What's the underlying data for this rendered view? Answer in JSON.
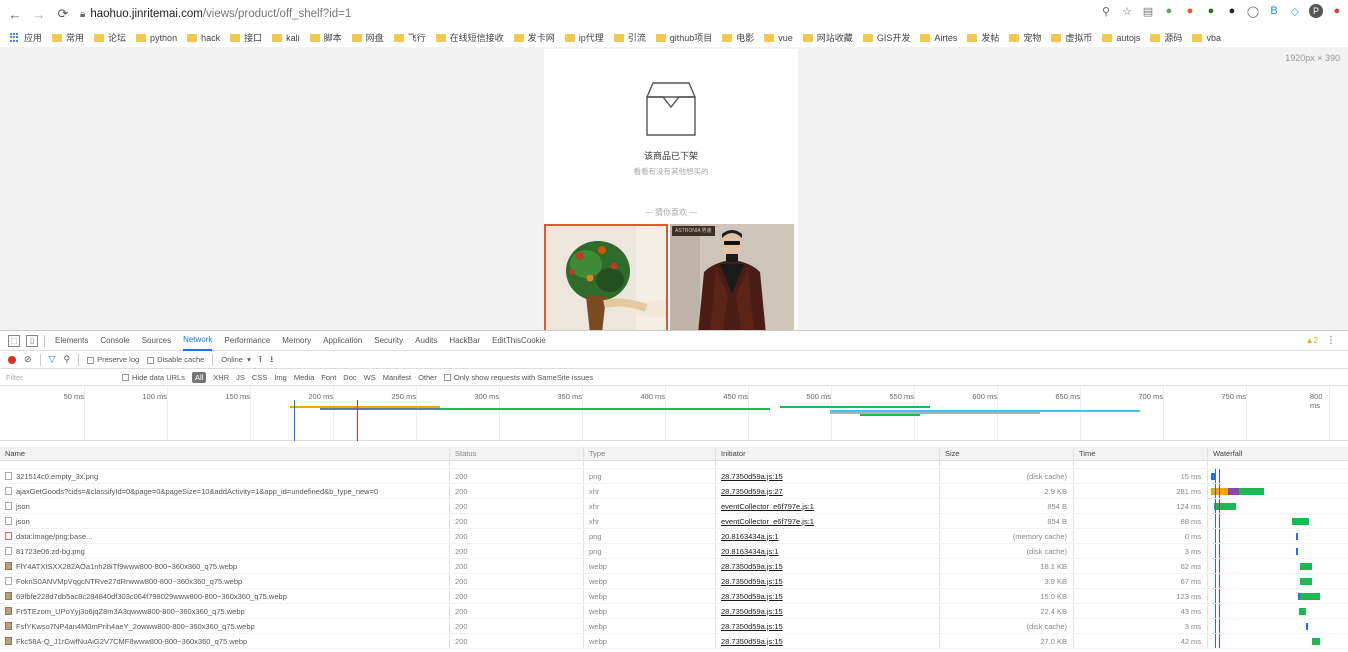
{
  "browser": {
    "url_host": "haohuo.jinritemai.com",
    "url_path": "/views/product/off_shelf?id=1",
    "extensions": [
      {
        "name": "zoom-icon",
        "label": "⚲",
        "color": "#666"
      },
      {
        "name": "star-icon",
        "label": "☆",
        "color": "#666"
      },
      {
        "name": "ext-1",
        "label": "▤",
        "color": "#7a7a7a"
      },
      {
        "name": "ext-2",
        "label": "●",
        "color": "#4caf50"
      },
      {
        "name": "ext-3",
        "label": "●",
        "color": "#f4511e"
      },
      {
        "name": "ext-4",
        "label": "●",
        "color": "#33691e"
      },
      {
        "name": "ext-5",
        "label": "●",
        "color": "#222"
      },
      {
        "name": "ext-6",
        "label": "◯",
        "color": "#666"
      },
      {
        "name": "ext-7",
        "label": "B",
        "color": "#1e88e5"
      },
      {
        "name": "ext-8",
        "label": "◇",
        "color": "#42a5f5"
      },
      {
        "name": "profile-avatar",
        "label": "P",
        "color": "#555"
      },
      {
        "name": "ext-9",
        "label": "●",
        "color": "#e53935"
      }
    ]
  },
  "bookmarks": [
    {
      "label": "应用",
      "type": "apps"
    },
    {
      "label": "常用"
    },
    {
      "label": "论坛"
    },
    {
      "label": "python"
    },
    {
      "label": "hack"
    },
    {
      "label": "接口"
    },
    {
      "label": "kali"
    },
    {
      "label": "脚本"
    },
    {
      "label": "网盘"
    },
    {
      "label": "飞行"
    },
    {
      "label": "在线短信接收"
    },
    {
      "label": "发卡网"
    },
    {
      "label": "ip代理"
    },
    {
      "label": "引流"
    },
    {
      "label": "github项目"
    },
    {
      "label": "电影"
    },
    {
      "label": "vue"
    },
    {
      "label": "网站收藏"
    },
    {
      "label": "GIS开发"
    },
    {
      "label": "Airtes"
    },
    {
      "label": "发帖"
    },
    {
      "label": "宠物"
    },
    {
      "label": "虚拟币"
    },
    {
      "label": "autojs"
    },
    {
      "label": "源码"
    },
    {
      "label": "vba"
    }
  ],
  "page": {
    "viewport_dims": "1920px × 390",
    "off_shelf_title": "该商品已下架",
    "off_shelf_subtitle": "看看有没有其他想买的",
    "guess_you_like": "— 猜你喜欢 —",
    "product2_badge": "ASTRONIA 男装"
  },
  "devtools": {
    "tabs": [
      "Elements",
      "Console",
      "Sources",
      "Network",
      "Performance",
      "Memory",
      "Application",
      "Security",
      "Audits",
      "HackBar",
      "EditThisCookie"
    ],
    "active_tab": "Network",
    "warning_count": "▲2",
    "preserve_log": "Preserve log",
    "disable_cache": "Disable cache",
    "throttling": "Online",
    "filter_placeholder": "Filter",
    "hide_data_urls": "Hide data URLs",
    "type_filters": [
      "XHR",
      "JS",
      "CSS",
      "Img",
      "Media",
      "Font",
      "Doc",
      "WS",
      "Manifest",
      "Other"
    ],
    "active_type": "All",
    "same_site": "Only show requests with SameSite issues",
    "timeline_ticks": [
      "50 ms",
      "100 ms",
      "150 ms",
      "200 ms",
      "250 ms",
      "300 ms",
      "350 ms",
      "400 ms",
      "450 ms",
      "500 ms",
      "550 ms",
      "600 ms",
      "650 ms",
      "700 ms",
      "750 ms",
      "800 ms"
    ],
    "columns": {
      "name": "Name",
      "status": "Status",
      "type": "Type",
      "initiator": "Initiator",
      "size": "Size",
      "time": "Time",
      "waterfall": "Waterfall"
    },
    "requests": [
      {
        "name": "321514c0.empty_3x.png",
        "status": "200",
        "type": "png",
        "initiator": "28.7350d59a.js:15",
        "size": "(disk cache)",
        "time": "15 ms",
        "icon": "file",
        "wf": [
          {
            "start": 0.02,
            "end": 0.06,
            "color": "#1a73e8"
          }
        ]
      },
      {
        "name": "ajaxGetGoods?cids=&classifyId=0&page=0&pageSize=10&addActivity=1&app_id=undefined&b_type_new=0",
        "status": "200",
        "type": "xhr",
        "initiator": "28.7350d59a.js:27",
        "size": "2.9 KB",
        "time": "281 ms",
        "icon": "file",
        "wf": [
          {
            "start": 0.02,
            "end": 0.14,
            "color": "#f4a300"
          },
          {
            "start": 0.14,
            "end": 0.22,
            "color": "#8e44ad"
          },
          {
            "start": 0.22,
            "end": 0.4,
            "color": "#1db954"
          }
        ]
      },
      {
        "name": "json",
        "status": "200",
        "type": "xhr",
        "initiator": "eventCollector_e6f797e.js:1",
        "size": "854 B",
        "time": "124 ms",
        "icon": "file",
        "wf": [
          {
            "start": 0.04,
            "end": 0.2,
            "color": "#1db954"
          }
        ]
      },
      {
        "name": "json",
        "status": "200",
        "type": "xhr",
        "initiator": "eventCollector_e6f797e.js:1",
        "size": "854 B",
        "time": "88 ms",
        "icon": "file",
        "wf": [
          {
            "start": 0.6,
            "end": 0.72,
            "color": "#1db954"
          }
        ]
      },
      {
        "name": "data:image/png;base...",
        "status": "200",
        "type": "png",
        "initiator": "20.8163434a.js:1",
        "size": "(memory cache)",
        "time": "0 ms",
        "icon": "red",
        "wf": [
          {
            "start": 0.63,
            "end": 0.645,
            "color": "#1a73e8"
          }
        ]
      },
      {
        "name": "81723e06.zd-bg.png",
        "status": "200",
        "type": "png",
        "initiator": "20.8163434a.js:1",
        "size": "(disk cache)",
        "time": "3 ms",
        "icon": "file",
        "wf": [
          {
            "start": 0.63,
            "end": 0.645,
            "color": "#1a73e8"
          }
        ]
      },
      {
        "name": "FlY4ATXtSXX282AOa1nh28iTf9www800-800~360x360_q75.webp",
        "status": "200",
        "type": "webp",
        "initiator": "28.7350d59a.js:15",
        "size": "18.1 KB",
        "time": "62 ms",
        "icon": "img",
        "wf": [
          {
            "start": 0.66,
            "end": 0.74,
            "color": "#1db954"
          }
        ]
      },
      {
        "name": "FoknS0ANVMpVqgcNTRve27dRrwww800-800~360x360_q75.webp",
        "status": "200",
        "type": "webp",
        "initiator": "28.7350d59a.js:15",
        "size": "3.9 KB",
        "time": "67 ms",
        "icon": "file",
        "wf": [
          {
            "start": 0.66,
            "end": 0.74,
            "color": "#1db954"
          }
        ]
      },
      {
        "name": "69fbfe228d7db5ac8c284840df303c064f798029www800-800~360x360_q75.webp",
        "status": "200",
        "type": "webp",
        "initiator": "28.7350d59a.js:15",
        "size": "15.0 KB",
        "time": "123 ms",
        "icon": "img",
        "wf": [
          {
            "start": 0.64,
            "end": 0.8,
            "color": "#1db954"
          },
          {
            "start": 0.64,
            "end": 0.66,
            "color": "#1a73e8"
          }
        ]
      },
      {
        "name": "Fr5TEzom_UPoYyj3o6jqZ8m3A3qwww800-800~360x360_q75.webp",
        "status": "200",
        "type": "webp",
        "initiator": "28.7350d59a.js:15",
        "size": "22.4 KB",
        "time": "43 ms",
        "icon": "img",
        "wf": [
          {
            "start": 0.65,
            "end": 0.7,
            "color": "#1db954"
          }
        ]
      },
      {
        "name": "FsfYKwso7NP4an4M0mPrih4aeY_2owww800-800~360x360_q75.webp",
        "status": "200",
        "type": "webp",
        "initiator": "28.7350d59a.js:15",
        "size": "(disk cache)",
        "time": "3 ms",
        "icon": "img",
        "wf": [
          {
            "start": 0.7,
            "end": 0.715,
            "color": "#1a73e8"
          }
        ]
      },
      {
        "name": "Fkc58A-Q_J1rGwfNuAiG2V7CMF8www800-800~360x360_q75.webp",
        "status": "200",
        "type": "webp",
        "initiator": "28.7350d59a.js:15",
        "size": "27.0 KB",
        "time": "42 ms",
        "icon": "img",
        "wf": [
          {
            "start": 0.74,
            "end": 0.8,
            "color": "#1db954"
          }
        ]
      }
    ],
    "colors": {
      "accent": "#1a73e8",
      "finish_line": "#d93025",
      "load_line": "#1a73e8"
    }
  }
}
